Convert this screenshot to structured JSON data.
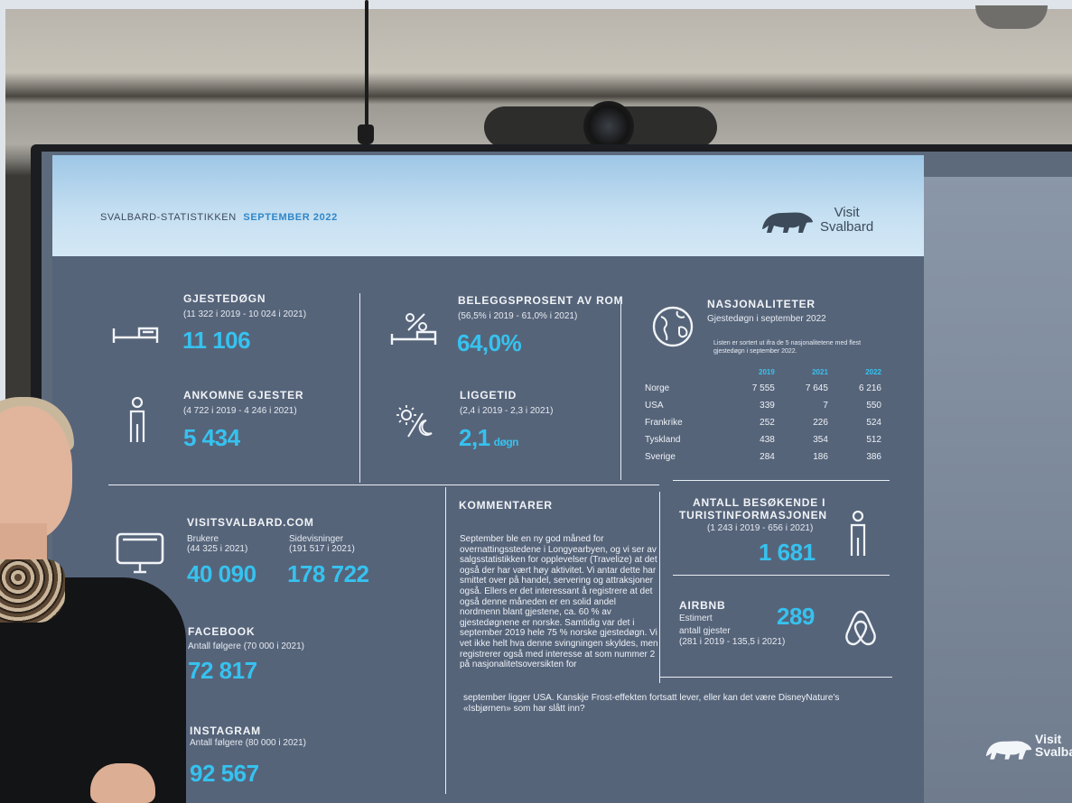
{
  "header": {
    "title": "SVALBARD-STATISTIKKEN",
    "period": "SEPTEMBER 2022",
    "logo_line1": "Visit",
    "logo_line2": "Svalbard"
  },
  "guest_nights": {
    "label": "GJESTEDØGN",
    "sub": "(11 322 i 2019 - 10 024 i 2021)",
    "value": "11 106",
    "icon": "bed-icon"
  },
  "arrivals": {
    "label": "ANKOMNE GJESTER",
    "sub": "(4 722 i 2019 - 4 246 i 2021)",
    "value": "5 434",
    "icon": "person-icon"
  },
  "occupancy": {
    "label": "BELEGGSPROSENT AV ROM",
    "sub": "(56,5% i 2019 - 61,0% i 2021)",
    "value": "64,0%",
    "icon": "bed-percent-icon"
  },
  "stay_length": {
    "label": "LIGGETID",
    "sub": "(2,4 i 2019 - 2,3 i 2021)",
    "value": "2,1",
    "unit": "døgn",
    "icon": "sun-moon-icon"
  },
  "nationalities": {
    "label": "NASJONALITETER",
    "sub": "Gjestedøgn i september 2022",
    "note": "Listen er sortert ut ifra de 5 nasjonalitetene med flest gjestedøgn i september 2022.",
    "icon": "globe-icon",
    "columns": [
      "2019",
      "2021",
      "2022"
    ],
    "rows": [
      {
        "country": "Norge",
        "y2019": "7 555",
        "y2021": "7 645",
        "y2022": "6 216"
      },
      {
        "country": "USA",
        "y2019": "339",
        "y2021": "7",
        "y2022": "550"
      },
      {
        "country": "Frankrike",
        "y2019": "252",
        "y2021": "226",
        "y2022": "524"
      },
      {
        "country": "Tyskland",
        "y2019": "438",
        "y2021": "354",
        "y2022": "512"
      },
      {
        "country": "Sverige",
        "y2019": "284",
        "y2021": "186",
        "y2022": "386"
      }
    ]
  },
  "web": {
    "label": "VISITSVALBARD.COM",
    "users_label": "Brukere",
    "users_sub": "(44 325 i 2021)",
    "users_value": "40 090",
    "views_label": "Sidevisninger",
    "views_sub": "(191 517 i 2021)",
    "views_value": "178 722",
    "icon": "monitor-icon"
  },
  "facebook": {
    "label": "FACEBOOK",
    "sub": "Antall følgere (70 000 i 2021)",
    "value": "72 817",
    "icon": "facebook-icon"
  },
  "instagram": {
    "label": "INSTAGRAM",
    "sub": "Antall følgere (80 000 i 2021)",
    "value": "92 567"
  },
  "comments": {
    "label": "KOMMENTARER",
    "body": "September ble en ny god måned for overnattingsstedene i Longyearbyen, og vi ser av salgsstatistikken for opplevelser (Travelize) at det også der har vært høy aktivitet. Vi antar dette har smittet over på handel, servering og attraksjoner også. Ellers er det interessant å registrere at det også denne måneden er en solid andel nordmenn blant gjestene, ca. 60 % av gjestedøgnene er norske. Samtidig var det i september 2019 hele 75 % norske gjestedøgn. Vi vet ikke helt hva denne svingningen skyldes, men registrerer også med interesse at som nummer 2 på nasjonalitetsoversikten for",
    "tail": "september ligger USA. Kanskje Frost-effekten fortsatt lever, eller kan det være DisneyNature's «Isbjørnen» som har slått inn?"
  },
  "tourist_info": {
    "label1": "ANTALL BESØKENDE I",
    "label2": "TURISTINFORMASJONEN",
    "sub": "(1 243 i 2019 - 656 i 2021)",
    "value": "1 681",
    "icon": "person-icon"
  },
  "airbnb": {
    "label": "AIRBNB",
    "sub1": "Estimert",
    "sub2": "antall gjester",
    "sub3": "(281 i 2019 - 135,5 i 2021)",
    "value": "289",
    "icon": "airbnb-icon"
  },
  "side_logo": {
    "line1": "Visit",
    "line2": "Svalbard"
  }
}
